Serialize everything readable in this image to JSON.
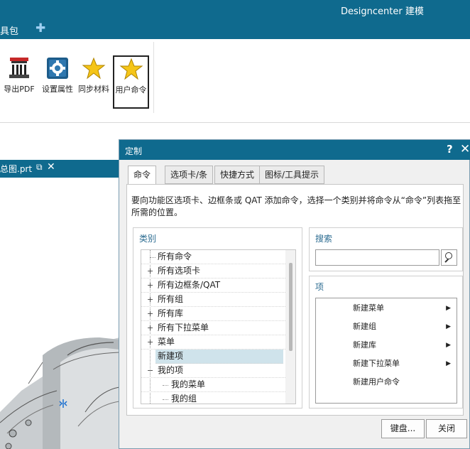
{
  "app": {
    "title": "Designcenter 建模",
    "menu_tab": "具包"
  },
  "ribbon": {
    "buttons": [
      {
        "label": "导出PDF",
        "icon": "pdf-export-icon"
      },
      {
        "label": "设置属性",
        "icon": "gear-settings-icon"
      },
      {
        "label": "同步材料",
        "icon": "star-icon"
      },
      {
        "label": "用户命令",
        "icon": "star-icon",
        "selected": true
      }
    ]
  },
  "file_tab": {
    "name": "总图.prt"
  },
  "dialog": {
    "title": "定制",
    "help": "?",
    "tabs": [
      "命令",
      "选项卡/条",
      "快捷方式",
      "图标/工具提示"
    ],
    "active_tab": "命令",
    "description": "要向功能区选项卡、边框条或 QAT 添加命令，选择一个类别并将命令从“命令”列表拖至所需的位置。",
    "categories": {
      "label": "类别",
      "items": [
        {
          "label": "所有命令",
          "expander": ""
        },
        {
          "label": "所有选项卡",
          "expander": "+"
        },
        {
          "label": "所有边框条/QAT",
          "expander": "+"
        },
        {
          "label": "所有组",
          "expander": "+"
        },
        {
          "label": "所有库",
          "expander": "+"
        },
        {
          "label": "所有下拉菜单",
          "expander": "+"
        },
        {
          "label": "菜单",
          "expander": "+"
        },
        {
          "label": "新建项",
          "expander": "",
          "selected": true
        },
        {
          "label": "我的项",
          "expander": "−"
        },
        {
          "label": "我的菜单",
          "expander": "",
          "child": true
        },
        {
          "label": "我的组",
          "expander": "",
          "child": true
        }
      ]
    },
    "search": {
      "label": "搜索",
      "value": "",
      "placeholder": ""
    },
    "items": {
      "label": "项",
      "list": [
        {
          "label": "新建菜单",
          "has_submenu": true
        },
        {
          "label": "新建组",
          "has_submenu": true
        },
        {
          "label": "新建库",
          "has_submenu": true
        },
        {
          "label": "新建下拉菜单",
          "has_submenu": true
        },
        {
          "label": "新建用户命令",
          "has_submenu": false
        }
      ]
    },
    "buttons": {
      "keyboard": "键盘...",
      "close": "关闭"
    }
  },
  "colors": {
    "titlebar": "#0f6a8e",
    "group_label": "#2e6d92",
    "selection": "#cfe3eb",
    "star": "#f5c518"
  }
}
